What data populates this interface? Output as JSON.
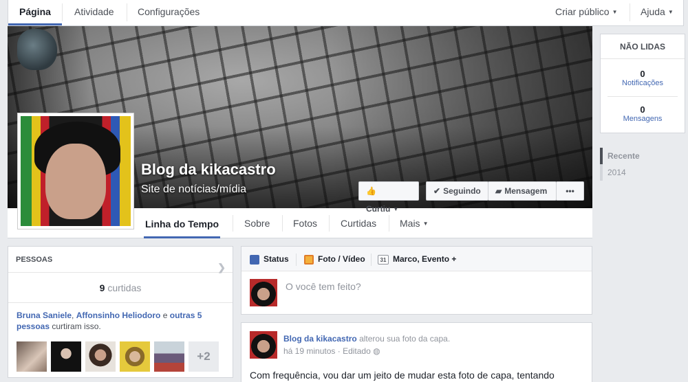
{
  "topbar": {
    "tabs": [
      {
        "label": "Página",
        "active": true
      },
      {
        "label": "Atividade",
        "active": false
      },
      {
        "label": "Configurações",
        "active": false
      }
    ],
    "create_public": "Criar público",
    "help": "Ajuda"
  },
  "page": {
    "name": "Blog da kikacastro",
    "category": "Site de notícias/mídia"
  },
  "cover_buttons": {
    "liked": "Curtiu",
    "following": "Seguindo",
    "message": "Mensagem",
    "more": "•••"
  },
  "page_nav": {
    "tabs": [
      "Linha do Tempo",
      "Sobre",
      "Fotos",
      "Curtidas",
      "Mais"
    ]
  },
  "unread": {
    "title": "NÃO LIDAS",
    "notifications_count": "0",
    "notifications_label": "Notificações",
    "messages_count": "0",
    "messages_label": "Mensagens"
  },
  "timeline_nav": {
    "items": [
      "Recente",
      "2014"
    ]
  },
  "people": {
    "title": "PESSOAS",
    "likes_count": "9",
    "likes_label": "curtidas",
    "friend1": "Bruna Saniele",
    "friend2": "Affonsinho Heliodoro",
    "conjunction": "e",
    "others": "outras 5 pessoas",
    "suffix": "curtiram isso.",
    "more_count": "+2"
  },
  "composer": {
    "tabs": [
      "Status",
      "Foto / Vídeo",
      "Marco, Evento +"
    ],
    "calendar_day": "31",
    "placeholder": "O você tem feito?"
  },
  "post": {
    "author": "Blog da kikacastro",
    "action": "alterou sua foto da capa.",
    "time": "há 19 minutos",
    "dot": "·",
    "edited": "Editado",
    "body": "Com frequência, vou dar um jeito de mudar esta foto de capa, tentando"
  },
  "colors": {
    "accent": "#4267b2",
    "background": "#e9ebee"
  }
}
